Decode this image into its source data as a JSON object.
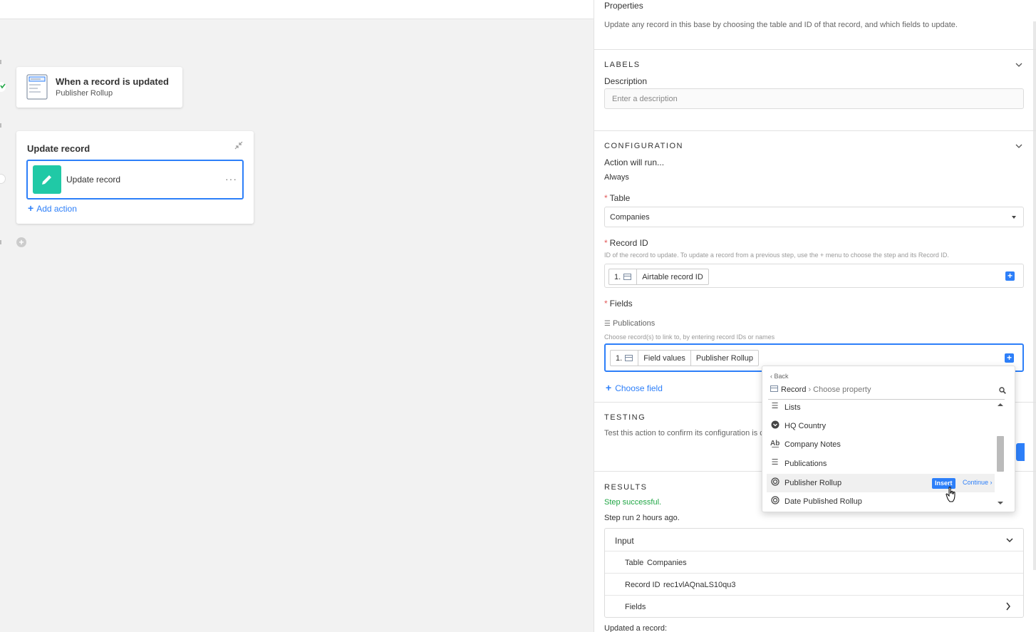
{
  "canvas": {
    "trigger": {
      "title": "When a record is updated",
      "subtitle": "Publisher Rollup"
    },
    "action_group": {
      "title": "Update record",
      "action_label": "Update record",
      "more_label": "···",
      "add_action_label": "Add action"
    }
  },
  "panel": {
    "title": "Properties",
    "description": "Update any record in this base by choosing the table and ID of that record, and which fields to update.",
    "labels_section": {
      "heading": "LABELS",
      "description_label": "Description",
      "description_placeholder": "Enter a description"
    },
    "configuration": {
      "heading": "CONFIGURATION",
      "run_label": "Action will run...",
      "run_value": "Always",
      "table_label": "Table",
      "table_value": "Companies",
      "record_id_label": "Record ID",
      "record_id_hint": "ID of the record to update. To update a record from a previous step, use the + menu to choose the step and its Record ID.",
      "record_id_token": {
        "step": "1.",
        "value": "Airtable record ID"
      },
      "fields_label": "Fields",
      "field_name": "Publications",
      "field_hint": "Choose record(s) to link to, by entering record IDs or names",
      "field_token": {
        "step": "1.",
        "part1": "Field values",
        "part2": "Publisher Rollup"
      },
      "choose_field_label": "Choose field"
    },
    "testing": {
      "heading": "TESTING",
      "description": "Test this action to confirm its configuration is c"
    },
    "results": {
      "heading": "RESULTS",
      "status": "Step successful.",
      "run_time": "Step run 2 hours ago.",
      "input_label": "Input",
      "rows": [
        {
          "key": "Table",
          "value": "Companies"
        },
        {
          "key": "Record ID",
          "value": "rec1vlAQnaLS10qu3"
        },
        {
          "key": "Fields",
          "value": ""
        }
      ],
      "updated_label": "Updated a record:"
    }
  },
  "dropdown": {
    "back_label": "Back",
    "crumb_root": "Record",
    "crumb_sep": "›",
    "crumb_current": "Choose property",
    "items": [
      {
        "label": "Lists",
        "icon": "multi-lines-icon"
      },
      {
        "label": "HQ Country",
        "icon": "single-select-icon"
      },
      {
        "label": "Company Notes",
        "icon": "long-text-icon"
      },
      {
        "label": "Publications",
        "icon": "linked-record-icon"
      },
      {
        "label": "Publisher Rollup",
        "icon": "rollup-icon"
      },
      {
        "label": "Date Published Rollup",
        "icon": "rollup-icon"
      }
    ],
    "insert_label": "Insert",
    "continue_label": "Continue ›"
  },
  "colors": {
    "accent": "#2d7ff9",
    "success": "#20a645",
    "action_icon": "#20c9a6"
  }
}
